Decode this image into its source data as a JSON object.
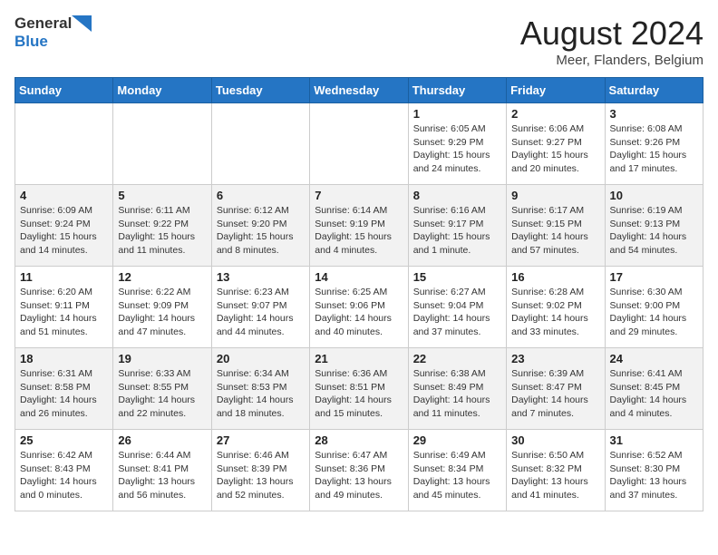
{
  "header": {
    "logo": {
      "line1": "General",
      "line2": "Blue"
    },
    "title": "August 2024",
    "subtitle": "Meer, Flanders, Belgium"
  },
  "weekdays": [
    "Sunday",
    "Monday",
    "Tuesday",
    "Wednesday",
    "Thursday",
    "Friday",
    "Saturday"
  ],
  "weeks": [
    [
      {
        "day": "",
        "info": ""
      },
      {
        "day": "",
        "info": ""
      },
      {
        "day": "",
        "info": ""
      },
      {
        "day": "",
        "info": ""
      },
      {
        "day": "1",
        "info": "Sunrise: 6:05 AM\nSunset: 9:29 PM\nDaylight: 15 hours\nand 24 minutes."
      },
      {
        "day": "2",
        "info": "Sunrise: 6:06 AM\nSunset: 9:27 PM\nDaylight: 15 hours\nand 20 minutes."
      },
      {
        "day": "3",
        "info": "Sunrise: 6:08 AM\nSunset: 9:26 PM\nDaylight: 15 hours\nand 17 minutes."
      }
    ],
    [
      {
        "day": "4",
        "info": "Sunrise: 6:09 AM\nSunset: 9:24 PM\nDaylight: 15 hours\nand 14 minutes."
      },
      {
        "day": "5",
        "info": "Sunrise: 6:11 AM\nSunset: 9:22 PM\nDaylight: 15 hours\nand 11 minutes."
      },
      {
        "day": "6",
        "info": "Sunrise: 6:12 AM\nSunset: 9:20 PM\nDaylight: 15 hours\nand 8 minutes."
      },
      {
        "day": "7",
        "info": "Sunrise: 6:14 AM\nSunset: 9:19 PM\nDaylight: 15 hours\nand 4 minutes."
      },
      {
        "day": "8",
        "info": "Sunrise: 6:16 AM\nSunset: 9:17 PM\nDaylight: 15 hours\nand 1 minute."
      },
      {
        "day": "9",
        "info": "Sunrise: 6:17 AM\nSunset: 9:15 PM\nDaylight: 14 hours\nand 57 minutes."
      },
      {
        "day": "10",
        "info": "Sunrise: 6:19 AM\nSunset: 9:13 PM\nDaylight: 14 hours\nand 54 minutes."
      }
    ],
    [
      {
        "day": "11",
        "info": "Sunrise: 6:20 AM\nSunset: 9:11 PM\nDaylight: 14 hours\nand 51 minutes."
      },
      {
        "day": "12",
        "info": "Sunrise: 6:22 AM\nSunset: 9:09 PM\nDaylight: 14 hours\nand 47 minutes."
      },
      {
        "day": "13",
        "info": "Sunrise: 6:23 AM\nSunset: 9:07 PM\nDaylight: 14 hours\nand 44 minutes."
      },
      {
        "day": "14",
        "info": "Sunrise: 6:25 AM\nSunset: 9:06 PM\nDaylight: 14 hours\nand 40 minutes."
      },
      {
        "day": "15",
        "info": "Sunrise: 6:27 AM\nSunset: 9:04 PM\nDaylight: 14 hours\nand 37 minutes."
      },
      {
        "day": "16",
        "info": "Sunrise: 6:28 AM\nSunset: 9:02 PM\nDaylight: 14 hours\nand 33 minutes."
      },
      {
        "day": "17",
        "info": "Sunrise: 6:30 AM\nSunset: 9:00 PM\nDaylight: 14 hours\nand 29 minutes."
      }
    ],
    [
      {
        "day": "18",
        "info": "Sunrise: 6:31 AM\nSunset: 8:58 PM\nDaylight: 14 hours\nand 26 minutes."
      },
      {
        "day": "19",
        "info": "Sunrise: 6:33 AM\nSunset: 8:55 PM\nDaylight: 14 hours\nand 22 minutes."
      },
      {
        "day": "20",
        "info": "Sunrise: 6:34 AM\nSunset: 8:53 PM\nDaylight: 14 hours\nand 18 minutes."
      },
      {
        "day": "21",
        "info": "Sunrise: 6:36 AM\nSunset: 8:51 PM\nDaylight: 14 hours\nand 15 minutes."
      },
      {
        "day": "22",
        "info": "Sunrise: 6:38 AM\nSunset: 8:49 PM\nDaylight: 14 hours\nand 11 minutes."
      },
      {
        "day": "23",
        "info": "Sunrise: 6:39 AM\nSunset: 8:47 PM\nDaylight: 14 hours\nand 7 minutes."
      },
      {
        "day": "24",
        "info": "Sunrise: 6:41 AM\nSunset: 8:45 PM\nDaylight: 14 hours\nand 4 minutes."
      }
    ],
    [
      {
        "day": "25",
        "info": "Sunrise: 6:42 AM\nSunset: 8:43 PM\nDaylight: 14 hours\nand 0 minutes."
      },
      {
        "day": "26",
        "info": "Sunrise: 6:44 AM\nSunset: 8:41 PM\nDaylight: 13 hours\nand 56 minutes."
      },
      {
        "day": "27",
        "info": "Sunrise: 6:46 AM\nSunset: 8:39 PM\nDaylight: 13 hours\nand 52 minutes."
      },
      {
        "day": "28",
        "info": "Sunrise: 6:47 AM\nSunset: 8:36 PM\nDaylight: 13 hours\nand 49 minutes."
      },
      {
        "day": "29",
        "info": "Sunrise: 6:49 AM\nSunset: 8:34 PM\nDaylight: 13 hours\nand 45 minutes."
      },
      {
        "day": "30",
        "info": "Sunrise: 6:50 AM\nSunset: 8:32 PM\nDaylight: 13 hours\nand 41 minutes."
      },
      {
        "day": "31",
        "info": "Sunrise: 6:52 AM\nSunset: 8:30 PM\nDaylight: 13 hours\nand 37 minutes."
      }
    ]
  ]
}
